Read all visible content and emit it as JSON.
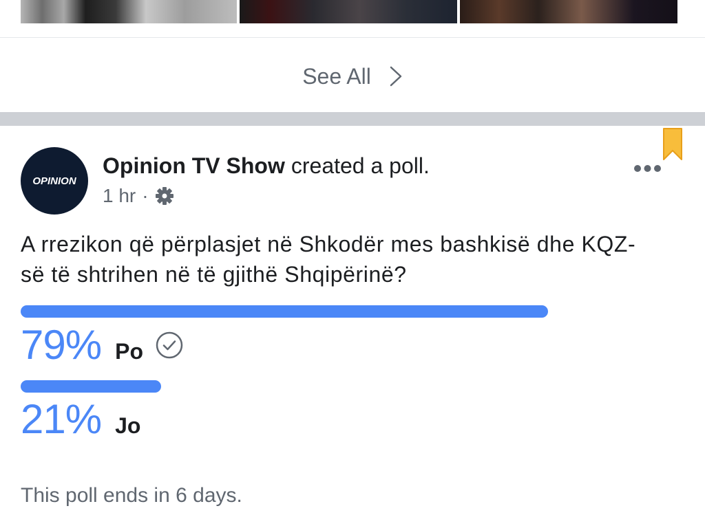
{
  "see_all": {
    "label": "See All"
  },
  "post": {
    "author": "Opinion TV Show",
    "action": "created a poll.",
    "time": "1 hr",
    "separator": "·",
    "avatar_logo_text": "OPINION",
    "question_lines": [
      "A rrezikon që përplasjet në Shkodër mes bashkisë dhe KQZ-",
      "së të shtrihen në të gjithë Shqipërinë?"
    ],
    "options": [
      {
        "percent_label": "79%",
        "label": "Po",
        "fraction": 0.79,
        "selected": true
      },
      {
        "percent_label": "21%",
        "label": "Jo",
        "fraction": 0.21,
        "selected": false
      }
    ],
    "footer": "This poll ends in 6 days."
  },
  "icons": {
    "see_all": "chevron-right-icon",
    "privacy": "gear-icon",
    "more": "more-options-icon",
    "saved": "bookmark-icon",
    "voted": "check-circle-icon"
  },
  "colors": {
    "accent": "#4b87f7",
    "secondary_text": "#606770",
    "bookmark": "#f8bd3b",
    "section_band": "#cdd0d5",
    "avatar_bg": "#0e1b30"
  }
}
